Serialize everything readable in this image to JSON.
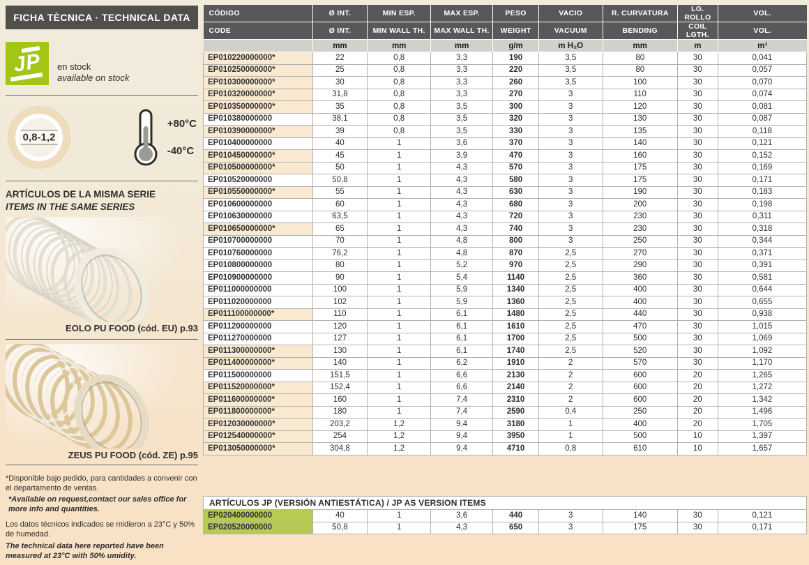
{
  "sidebar": {
    "title": "FICHA TÈCNICA · TECHNICAL DATA",
    "logo_text": "JP",
    "stock": {
      "line1": "en stock",
      "line2": "available on stock"
    },
    "wall_thickness_badge": "0,8-1,2",
    "temperature": {
      "max": "+80°C",
      "min": "-40°C"
    },
    "same_series": {
      "line1": "ARTÍCULOS DE LA MISMA SERIE",
      "line2": "ITEMS IN THE SAME SERIES"
    },
    "products": [
      {
        "caption": "EOLO PU FOOD (cód. EU) p.93"
      },
      {
        "caption": "ZEUS PU FOOD (cód. ZE) p.95"
      }
    ],
    "footnotes": [
      {
        "text": "*Disponible bajo pedido, para cantidades a convenir con el departamento de ventas."
      },
      {
        "text": "*Available on request,contact our sales office for more info and quantities."
      },
      {
        "text": "Los datos técnicos indicados se midieron a 23°C y 50% de humedad."
      },
      {
        "text": "The technical data here reported have been measured at 23°C with 50% umidity."
      }
    ]
  },
  "colors": {
    "accent_green": "#a3c616",
    "row_green": "#b5cb52",
    "row_beige": "#f8e9d0",
    "header_gray": "#58585a",
    "units_gray": "#d2d0ca"
  },
  "table": {
    "columns": [
      {
        "es": "CÓDIGO",
        "en": "CODE",
        "unit": ""
      },
      {
        "es": "Ø INT.",
        "en": "Ø INT.",
        "unit": "mm"
      },
      {
        "es": "MIN ESP.",
        "en": "MIN WALL TH.",
        "unit": "mm"
      },
      {
        "es": "MAX ESP.",
        "en": "MAX WALL TH.",
        "unit": "mm"
      },
      {
        "es": "PESO",
        "en": "WEIGHT",
        "unit": "g/m"
      },
      {
        "es": "VACIO",
        "en": "VACUUM",
        "unit": "m H₂O"
      },
      {
        "es": "R. CURVATURA",
        "en": "BENDING",
        "unit": "mm"
      },
      {
        "es": "LG. ROLLO",
        "en": "COIL LGTH.",
        "unit": "m"
      },
      {
        "es": "VOL.",
        "en": "VOL.",
        "unit": "m³"
      }
    ],
    "rows": [
      [
        "EP010220000000*",
        "22",
        "0,8",
        "3,3",
        "190",
        "3,5",
        "80",
        "30",
        "0,041"
      ],
      [
        "EP010250000000*",
        "25",
        "0,8",
        "3,3",
        "220",
        "3,5",
        "80",
        "30",
        "0,057"
      ],
      [
        "EP010300000000*",
        "30",
        "0,8",
        "3,3",
        "260",
        "3,5",
        "100",
        "30",
        "0,070"
      ],
      [
        "EP010320000000*",
        "31,8",
        "0,8",
        "3,3",
        "270",
        "3",
        "110",
        "30",
        "0,074"
      ],
      [
        "EP010350000000*",
        "35",
        "0,8",
        "3,5",
        "300",
        "3",
        "120",
        "30",
        "0,081"
      ],
      [
        "EP010380000000",
        "38,1",
        "0,8",
        "3,5",
        "320",
        "3",
        "130",
        "30",
        "0,087"
      ],
      [
        "EP010390000000*",
        "39",
        "0,8",
        "3,5",
        "330",
        "3",
        "135",
        "30",
        "0,118"
      ],
      [
        "EP010400000000",
        "40",
        "1",
        "3,6",
        "370",
        "3",
        "140",
        "30",
        "0,121"
      ],
      [
        "EP010450000000*",
        "45",
        "1",
        "3,9",
        "470",
        "3",
        "160",
        "30",
        "0,152"
      ],
      [
        "EP010500000000*",
        "50",
        "1",
        "4,3",
        "570",
        "3",
        "175",
        "30",
        "0,169"
      ],
      [
        "EP010520000000",
        "50,8",
        "1",
        "4,3",
        "580",
        "3",
        "175",
        "30",
        "0,171"
      ],
      [
        "EP010550000000*",
        "55",
        "1",
        "4,3",
        "630",
        "3",
        "190",
        "30",
        "0,183"
      ],
      [
        "EP010600000000",
        "60",
        "1",
        "4,3",
        "680",
        "3",
        "200",
        "30",
        "0,198"
      ],
      [
        "EP010630000000",
        "63,5",
        "1",
        "4,3",
        "720",
        "3",
        "230",
        "30",
        "0,311"
      ],
      [
        "EP010650000000*",
        "65",
        "1",
        "4,3",
        "740",
        "3",
        "230",
        "30",
        "0,318"
      ],
      [
        "EP010700000000",
        "70",
        "1",
        "4,8",
        "800",
        "3",
        "250",
        "30",
        "0,344"
      ],
      [
        "EP010760000000",
        "76,2",
        "1",
        "4,8",
        "870",
        "2,5",
        "270",
        "30",
        "0,371"
      ],
      [
        "EP010800000000",
        "80",
        "1",
        "5,2",
        "970",
        "2,5",
        "290",
        "30",
        "0,391"
      ],
      [
        "EP010900000000",
        "90",
        "1",
        "5,4",
        "1140",
        "2,5",
        "360",
        "30",
        "0,581"
      ],
      [
        "EP011000000000",
        "100",
        "1",
        "5,9",
        "1340",
        "2,5",
        "400",
        "30",
        "0,644"
      ],
      [
        "EP011020000000",
        "102",
        "1",
        "5,9",
        "1360",
        "2,5",
        "400",
        "30",
        "0,655"
      ],
      [
        "EP011100000000*",
        "110",
        "1",
        "6,1",
        "1480",
        "2,5",
        "440",
        "30",
        "0,938"
      ],
      [
        "EP011200000000",
        "120",
        "1",
        "6,1",
        "1610",
        "2,5",
        "470",
        "30",
        "1,015"
      ],
      [
        "EP011270000000",
        "127",
        "1",
        "6,1",
        "1700",
        "2,5",
        "500",
        "30",
        "1,069"
      ],
      [
        "EP011300000000*",
        "130",
        "1",
        "6,1",
        "1740",
        "2,5",
        "520",
        "30",
        "1,092"
      ],
      [
        "EP011400000000*",
        "140",
        "1",
        "6,2",
        "1910",
        "2",
        "570",
        "30",
        "1,170"
      ],
      [
        "EP011500000000",
        "151,5",
        "1",
        "6,6",
        "2130",
        "2",
        "600",
        "20",
        "1,265"
      ],
      [
        "EP011520000000*",
        "152,4",
        "1",
        "6,6",
        "2140",
        "2",
        "600",
        "20",
        "1,272"
      ],
      [
        "EP011600000000*",
        "160",
        "1",
        "7,4",
        "2310",
        "2",
        "600",
        "20",
        "1,342"
      ],
      [
        "EP011800000000*",
        "180",
        "1",
        "7,4",
        "2590",
        "0,4",
        "250",
        "20",
        "1,496"
      ],
      [
        "EP012030000000*",
        "203,2",
        "1,2",
        "9,4",
        "3180",
        "1",
        "400",
        "20",
        "1,705"
      ],
      [
        "EP012540000000*",
        "254",
        "1,2",
        "9,4",
        "3950",
        "1",
        "500",
        "10",
        "1,397"
      ],
      [
        "EP013050000000*",
        "304,8",
        "1,2",
        "9,4",
        "4710",
        "0,8",
        "610",
        "10",
        "1,657"
      ]
    ]
  },
  "as_table": {
    "title": "ARTÍCULOS JP (VERSIÓN ANTIESTÁTICA) / JP AS VERSION ITEMS",
    "rows": [
      [
        "EP020400000000",
        "40",
        "1",
        "3,6",
        "440",
        "3",
        "140",
        "30",
        "0,121"
      ],
      [
        "EP020520000000",
        "50,8",
        "1",
        "4,3",
        "650",
        "3",
        "175",
        "30",
        "0,171"
      ]
    ]
  }
}
